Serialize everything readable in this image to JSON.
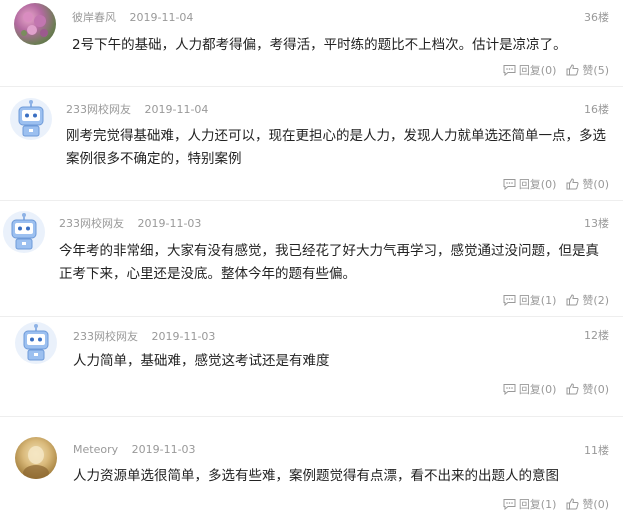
{
  "comments": [
    {
      "user": "彼岸春风",
      "date": "2019-11-04",
      "floor": "36楼",
      "text": "2号下午的基础，人力都考得偏，考得活，平时练的题比不上档次。估计是凉凉了。",
      "reply_label": "回复(0)",
      "like_label": "赞(5)",
      "avatar_icon": "flower-photo-avatar"
    },
    {
      "user": "233网校网友",
      "date": "2019-11-04",
      "floor": "16楼",
      "text": "刚考完觉得基础难，人力还可以，现在更担心的是人力，发现人力就单选还简单一点，多选案例很多不确定的，特别案例",
      "reply_label": "回复(0)",
      "like_label": "赞(0)",
      "avatar_icon": "robot-avatar"
    },
    {
      "user": "233网校网友",
      "date": "2019-11-03",
      "floor": "13楼",
      "text": "今年考的非常细，大家有没有感觉，我已经花了好大力气再学习，感觉通过没问题，但是真正考下来，心里还是没底。整体今年的题有些偏。",
      "reply_label": "回复(1)",
      "like_label": "赞(2)",
      "avatar_icon": "robot-avatar"
    },
    {
      "user": "233网校网友",
      "date": "2019-11-03",
      "floor": "12楼",
      "text": "人力简单，基础难，感觉这考试还是有难度",
      "reply_label": "回复(0)",
      "like_label": "赞(0)",
      "avatar_icon": "robot-avatar"
    },
    {
      "user": "Meteory",
      "date": "2019-11-03",
      "floor": "11楼",
      "text": "人力资源单选很简单，多选有些难，案例题觉得有点漂，看不出来的出题人的意图",
      "reply_label": "回复(1)",
      "like_label": "赞(0)",
      "avatar_icon": "photo-avatar"
    }
  ]
}
